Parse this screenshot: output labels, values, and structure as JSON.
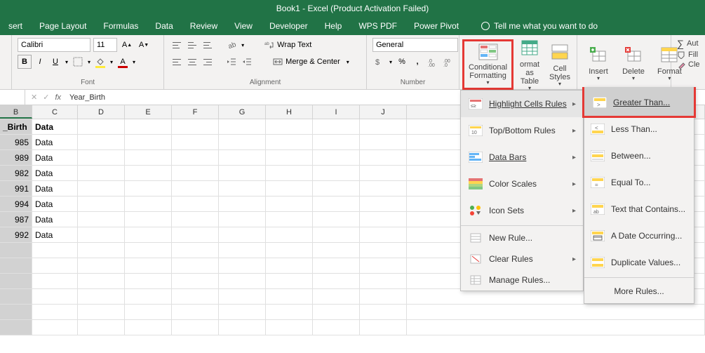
{
  "titlebar": "Book1  -  Excel (Product Activation Failed)",
  "tabs": [
    "sert",
    "Page Layout",
    "Formulas",
    "Data",
    "Review",
    "View",
    "Developer",
    "Help",
    "WPS PDF",
    "Power Pivot"
  ],
  "tellme": "Tell me what you want to do",
  "font": {
    "name": "Calibri",
    "size": "11"
  },
  "alignment": {
    "wrap": "Wrap Text",
    "merge": "Merge & Center"
  },
  "number": {
    "format": "General"
  },
  "styles": {
    "cf": "Conditional Formatting",
    "fat": "ormat as Table",
    "cs": "Cell Styles"
  },
  "cells": {
    "insert": "Insert",
    "delete": "Delete",
    "format": "Format"
  },
  "editing": {
    "autosum": "Aut",
    "fill": "Fill",
    "clear": "Cle"
  },
  "group_labels": {
    "font": "Font",
    "alignment": "Alignment",
    "number": "Number"
  },
  "formula_bar": {
    "value": "Year_Birth"
  },
  "cf_menu": {
    "highlight": "Highlight Cells Rules",
    "topbottom": "Top/Bottom Rules",
    "databars": "Data Bars",
    "colorscales": "Color Scales",
    "iconsets": "Icon Sets",
    "newrule": "New Rule...",
    "clearrules": "Clear Rules",
    "managerules": "Manage Rules..."
  },
  "sub_menu": {
    "gt": "Greater Than...",
    "lt": "Less Than...",
    "between": "Between...",
    "equal": "Equal To...",
    "textcontains": "Text that Contains...",
    "dateoccurring": "A Date Occurring...",
    "duplicate": "Duplicate Values...",
    "morerules": "More Rules..."
  },
  "columns": [
    "B",
    "C",
    "D",
    "E",
    "F",
    "G",
    "H",
    "I",
    "J"
  ],
  "rows": [
    {
      "b": "_Birth",
      "c": "Data",
      "bold": true
    },
    {
      "b": "985",
      "c": "Data"
    },
    {
      "b": "989",
      "c": "Data"
    },
    {
      "b": "982",
      "c": "Data"
    },
    {
      "b": "991",
      "c": "Data"
    },
    {
      "b": "994",
      "c": "Data"
    },
    {
      "b": "987",
      "c": "Data"
    },
    {
      "b": "992",
      "c": "Data"
    }
  ],
  "col_widths": {
    "B": 46,
    "C": 65,
    "other": 67
  }
}
